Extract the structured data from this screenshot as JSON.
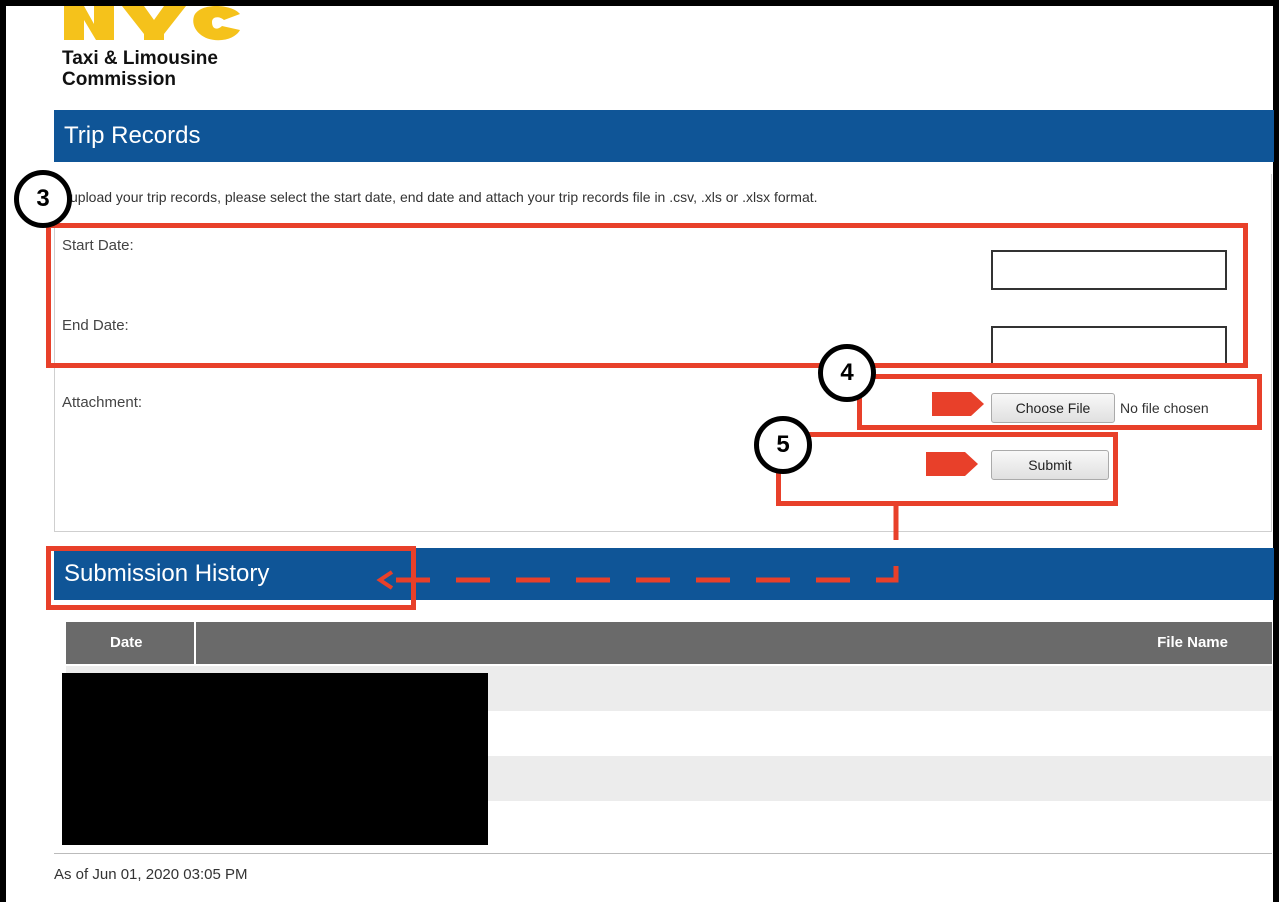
{
  "logo": {
    "mark": "NYC",
    "line1": "Taxi & Limousine",
    "line2": "Commission"
  },
  "trip_records": {
    "title": "Trip Records",
    "instruction": "upload your trip records, please select the start date, end date and attach your trip records file in .csv, .xls or .xlsx format.",
    "start_date_label": "Start Date:",
    "end_date_label": "End Date:",
    "attachment_label": "Attachment:",
    "choose_file_label": "Choose File",
    "no_file_text": "No file chosen",
    "submit_label": "Submit"
  },
  "submission_history": {
    "title": "Submission History",
    "columns": [
      "Date",
      "File Name"
    ]
  },
  "footer": {
    "timestamp": "As of Jun 01, 2020 03:05 PM"
  },
  "annotations": {
    "step3": "3",
    "step4": "4",
    "step5": "5"
  },
  "colors": {
    "header_blue": "#0f5597",
    "callout_red": "#e8402a",
    "table_header_gray": "#6a6a6a",
    "logo_yellow": "#f5c21b"
  }
}
